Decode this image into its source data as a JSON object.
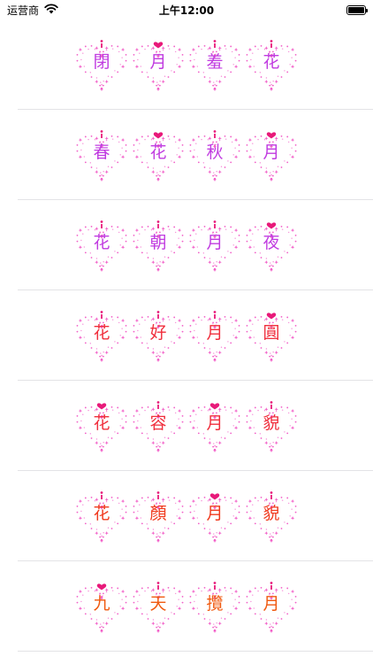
{
  "status_bar": {
    "carrier": "运营商",
    "time": "上午12:00"
  },
  "idioms": [
    {
      "chars": [
        "閉",
        "月",
        "羞",
        "花"
      ],
      "color": "#c03be0"
    },
    {
      "chars": [
        "春",
        "花",
        "秋",
        "月"
      ],
      "color": "#c03be0"
    },
    {
      "chars": [
        "花",
        "朝",
        "月",
        "夜"
      ],
      "color": "#c03be0"
    },
    {
      "chars": [
        "花",
        "好",
        "月",
        "圓"
      ],
      "color": "#f02e3c"
    },
    {
      "chars": [
        "花",
        "容",
        "月",
        "貌"
      ],
      "color": "#f02e3c"
    },
    {
      "chars": [
        "花",
        "顏",
        "月",
        "貌"
      ],
      "color": "#f03a1e"
    },
    {
      "chars": [
        "九",
        "天",
        "攬",
        "月"
      ],
      "color": "#f05a10"
    }
  ],
  "heart_colors": {
    "sparkle": "#f25fc8",
    "topper": "#e8197a"
  }
}
